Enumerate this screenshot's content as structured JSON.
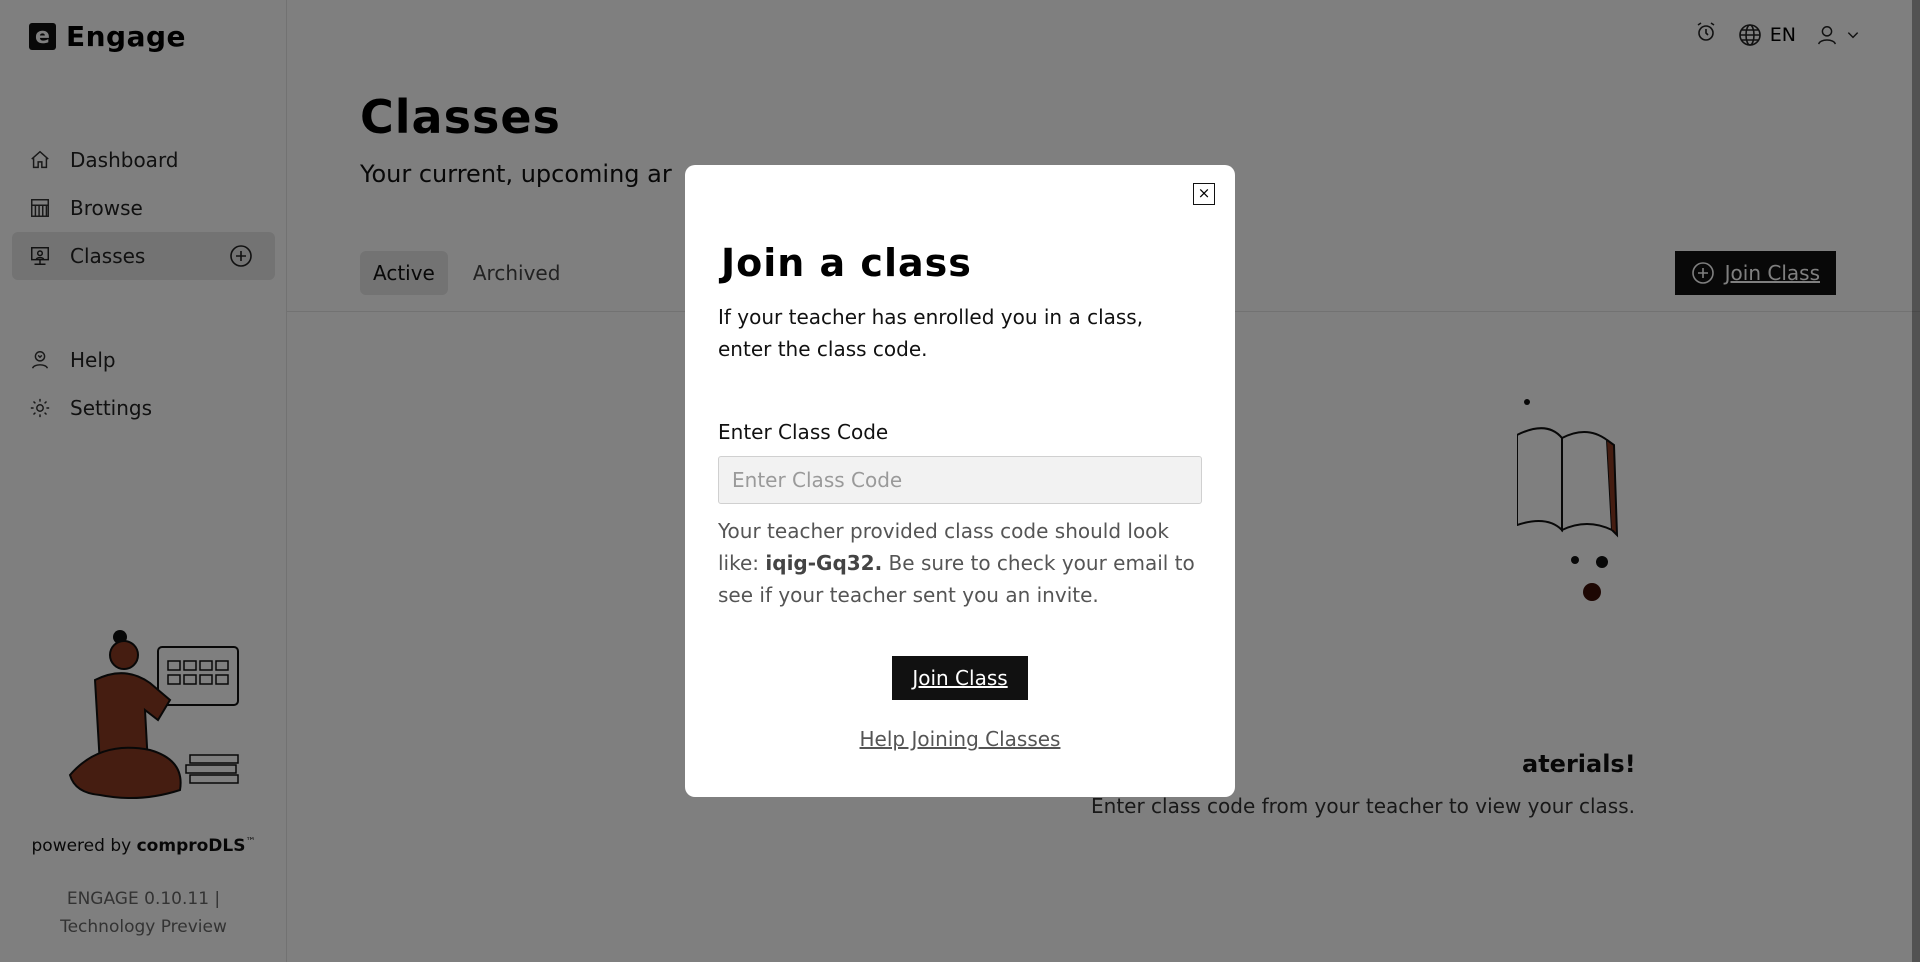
{
  "app": {
    "name": "Engage",
    "logo_letter": "e"
  },
  "sidebar": {
    "items": [
      {
        "label": "Dashboard",
        "icon": "home-icon"
      },
      {
        "label": "Browse",
        "icon": "library-icon"
      },
      {
        "label": "Classes",
        "icon": "classroom-icon",
        "active": true
      },
      {
        "label": "Help",
        "icon": "help-person-icon"
      },
      {
        "label": "Settings",
        "icon": "gear-icon"
      }
    ],
    "powered_prefix": "powered by",
    "powered_brand": "comproDLS",
    "powered_tm": "™",
    "version_line1": "ENGAGE 0.10.11 |",
    "version_line2": "Technology Preview"
  },
  "topbar": {
    "language": "EN"
  },
  "main": {
    "title": "Classes",
    "subtitle": "Your current, upcoming ar",
    "tabs": [
      {
        "label": "Active",
        "active": true
      },
      {
        "label": "Archived",
        "active": false
      }
    ],
    "join_button": "Join Class",
    "empty_title": "aterials!",
    "empty_subtitle": "Enter class code from your teacher to view your class."
  },
  "modal": {
    "close_symbol": "×",
    "title": "Join a class",
    "description": "If your teacher has enrolled you in a class, enter the class code.",
    "field_label": "Enter Class Code",
    "input_value": "",
    "input_placeholder": "Enter Class Code",
    "hint_before": "Your teacher provided class code should look like: ",
    "hint_code": "iqig-Gq32.",
    "hint_after": " Be sure to check your email to see if your teacher sent you an invite.",
    "join_button": "Join Class",
    "help_link": "Help Joining Classes"
  },
  "colors": {
    "accent": "#111111",
    "illustration": "#8b3a22",
    "overlay": "rgba(0,0,0,0.5)"
  }
}
